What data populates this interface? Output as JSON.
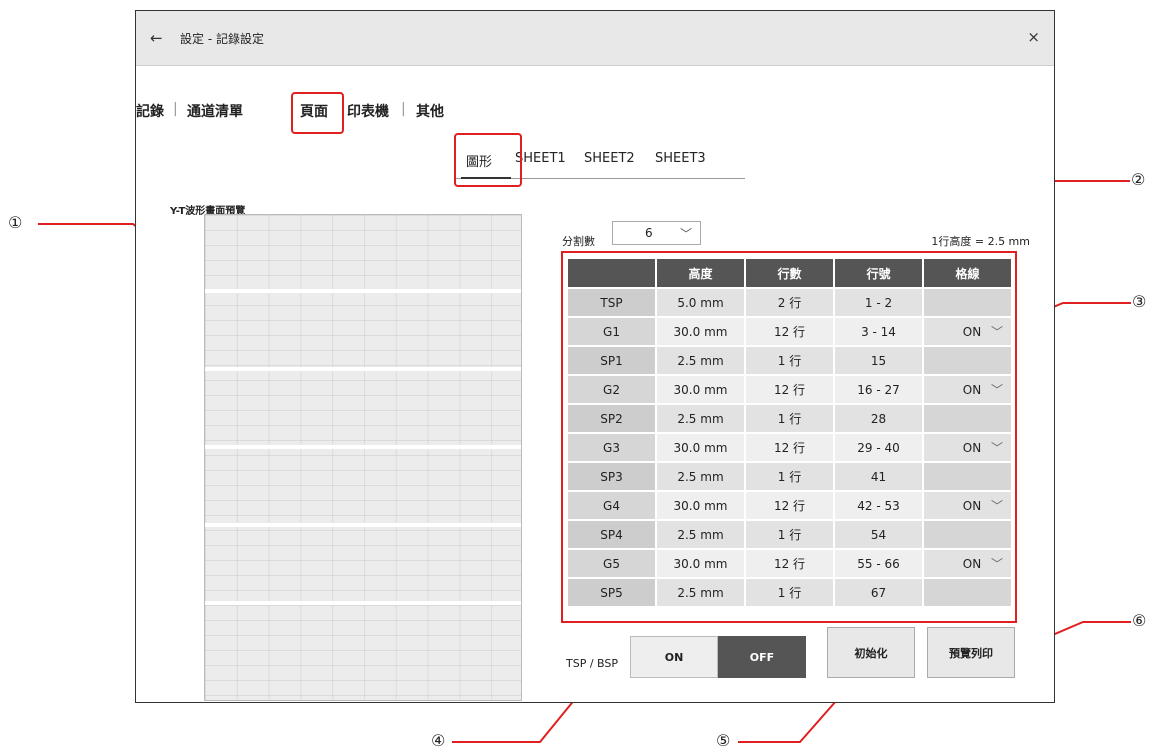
{
  "window": {
    "back_icon": "←",
    "title": "設定 - 記錄設定",
    "close_icon": "×"
  },
  "tabs": [
    {
      "label": "記錄"
    },
    {
      "label": "通道清單"
    },
    {
      "label": "頁面"
    },
    {
      "label": "印表機"
    },
    {
      "label": "其他"
    }
  ],
  "subtabs": [
    {
      "label": "圖形"
    },
    {
      "label": "SHEET1"
    },
    {
      "label": "SHEET2"
    },
    {
      "label": "SHEET3"
    }
  ],
  "preview": {
    "label": "Y-T波形畫面預覽"
  },
  "divisions": {
    "label": "分割數",
    "value": "6",
    "chevron": "﹀"
  },
  "row_height": "1行高度 = 2.5 mm",
  "table": {
    "headers": [
      "",
      "高度",
      "行數",
      "行號",
      "格線"
    ],
    "rows": [
      {
        "name": "TSP",
        "height": "5.0 mm",
        "rows": "2 行",
        "numbers": "1 - 2",
        "grid": ""
      },
      {
        "name": "G1",
        "height": "30.0 mm",
        "rows": "12 行",
        "numbers": "3 - 14",
        "grid": "ON"
      },
      {
        "name": "SP1",
        "height": "2.5 mm",
        "rows": "1 行",
        "numbers": "15",
        "grid": ""
      },
      {
        "name": "G2",
        "height": "30.0 mm",
        "rows": "12 行",
        "numbers": "16 - 27",
        "grid": "ON"
      },
      {
        "name": "SP2",
        "height": "2.5 mm",
        "rows": "1 行",
        "numbers": "28",
        "grid": ""
      },
      {
        "name": "G3",
        "height": "30.0 mm",
        "rows": "12 行",
        "numbers": "29 - 40",
        "grid": "ON"
      },
      {
        "name": "SP3",
        "height": "2.5 mm",
        "rows": "1 行",
        "numbers": "41",
        "grid": ""
      },
      {
        "name": "G4",
        "height": "30.0 mm",
        "rows": "12 行",
        "numbers": "42 - 53",
        "grid": "ON"
      },
      {
        "name": "SP4",
        "height": "2.5 mm",
        "rows": "1 行",
        "numbers": "54",
        "grid": ""
      },
      {
        "name": "G5",
        "height": "30.0 mm",
        "rows": "12 行",
        "numbers": "55 - 66",
        "grid": "ON"
      },
      {
        "name": "SP5",
        "height": "2.5 mm",
        "rows": "1 行",
        "numbers": "67",
        "grid": ""
      }
    ]
  },
  "tsp_bsp": {
    "label": "TSP / BSP",
    "on": "ON",
    "off": "OFF",
    "selected": "OFF"
  },
  "buttons": {
    "init": "初始化",
    "print_preview": "預覽列印"
  },
  "callouts": [
    "①",
    "②",
    "③",
    "④",
    "⑤",
    "⑥"
  ],
  "colors": {
    "highlight": "#e02020",
    "header": "#555555"
  }
}
